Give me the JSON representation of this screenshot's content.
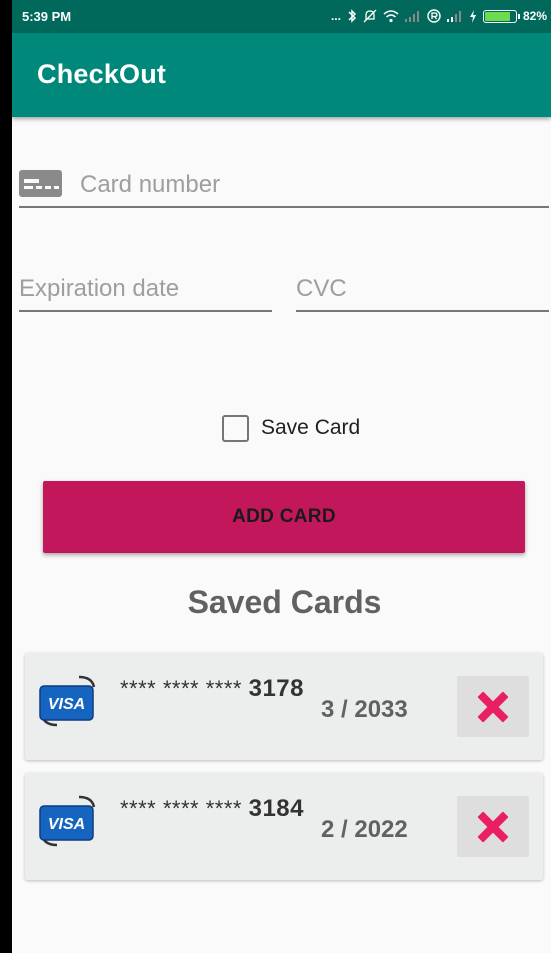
{
  "status_bar": {
    "time": "5:39 PM",
    "dots": "...",
    "battery_percent": "82%",
    "battery_level": 0.82
  },
  "app_bar": {
    "title": "CheckOut"
  },
  "form": {
    "card_number_placeholder": "Card number",
    "expiration_placeholder": "Expiration date",
    "cvc_placeholder": "CVC",
    "save_card_label": "Save Card",
    "save_card_checked": false,
    "add_card_label": "ADD CARD"
  },
  "saved_cards": {
    "title": "Saved Cards",
    "items": [
      {
        "brand": "VISA",
        "mask": "**** **** ****",
        "last4": "3178",
        "expiry": "3 / 2033"
      },
      {
        "brand": "VISA",
        "mask": "**** **** ****",
        "last4": "3184",
        "expiry": "2 / 2022"
      }
    ]
  },
  "colors": {
    "status_bar": "#00695c",
    "app_bar": "#00897b",
    "accent": "#c2185b",
    "delete_icon": "#e91e63",
    "visa_blue": "#1565c0"
  },
  "icons": [
    "card-icon",
    "bluetooth-icon",
    "mute-icon",
    "wifi-icon",
    "signal-icon",
    "battery-icon",
    "visa-logo",
    "close-icon"
  ]
}
